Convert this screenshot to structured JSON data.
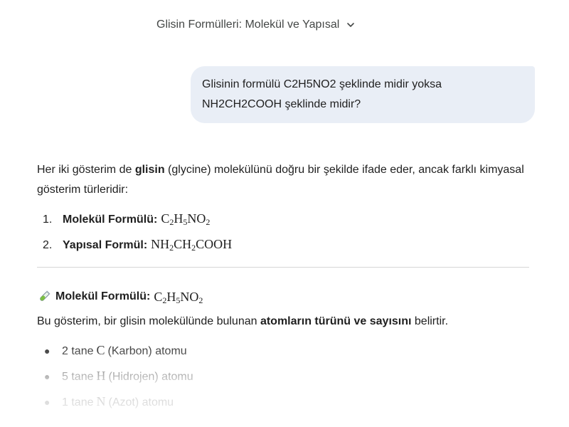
{
  "header": {
    "conversation_title": "Glisin Formülleri: Molekül ve Yapısal",
    "dropdown_icon": "chevron-down-icon"
  },
  "user_message": {
    "text": "Glisinin formülü C2H5NO2 şeklinde midir yoksa NH2CH2COOH şeklinde midir?"
  },
  "response": {
    "intro": {
      "before": "Her iki gösterim de ",
      "bold": "glisin",
      "after": " (glycine) molekülünü doğru bir şekilde ifade eder, ancak farklı kimyasal gösterim türleridir:"
    },
    "numbered": [
      {
        "marker": "1.",
        "label": "Molekül Formülü:",
        "formula": [
          {
            "t": "C"
          },
          {
            "s": "2"
          },
          {
            "t": "H"
          },
          {
            "s": "5"
          },
          {
            "t": "NO"
          },
          {
            "s": "2"
          }
        ]
      },
      {
        "marker": "2.",
        "label": "Yapısal Formül:",
        "formula": [
          {
            "t": "NH"
          },
          {
            "s": "2"
          },
          {
            "t": "CH"
          },
          {
            "s": "2"
          },
          {
            "t": "COOH"
          }
        ]
      }
    ],
    "section": {
      "icon": "test-tube-icon",
      "label": "Molekül Formülü:",
      "formula": [
        {
          "t": "C"
        },
        {
          "s": "2"
        },
        {
          "t": "H"
        },
        {
          "s": "5"
        },
        {
          "t": "NO"
        },
        {
          "s": "2"
        }
      ],
      "description": {
        "before": "Bu gösterim, bir glisin molekülünde bulunan ",
        "bold": "atomların türünü ve sayısını",
        "after": " belirtir."
      },
      "bullets": [
        {
          "count": "2 tane",
          "atom": "C",
          "rest": "(Karbon) atomu"
        },
        {
          "count": "5 tane",
          "atom": "H",
          "rest": "(Hidrojen) atomu"
        },
        {
          "count": "1 tane",
          "atom": "N",
          "rest": "(Azot) atomu"
        }
      ]
    }
  }
}
